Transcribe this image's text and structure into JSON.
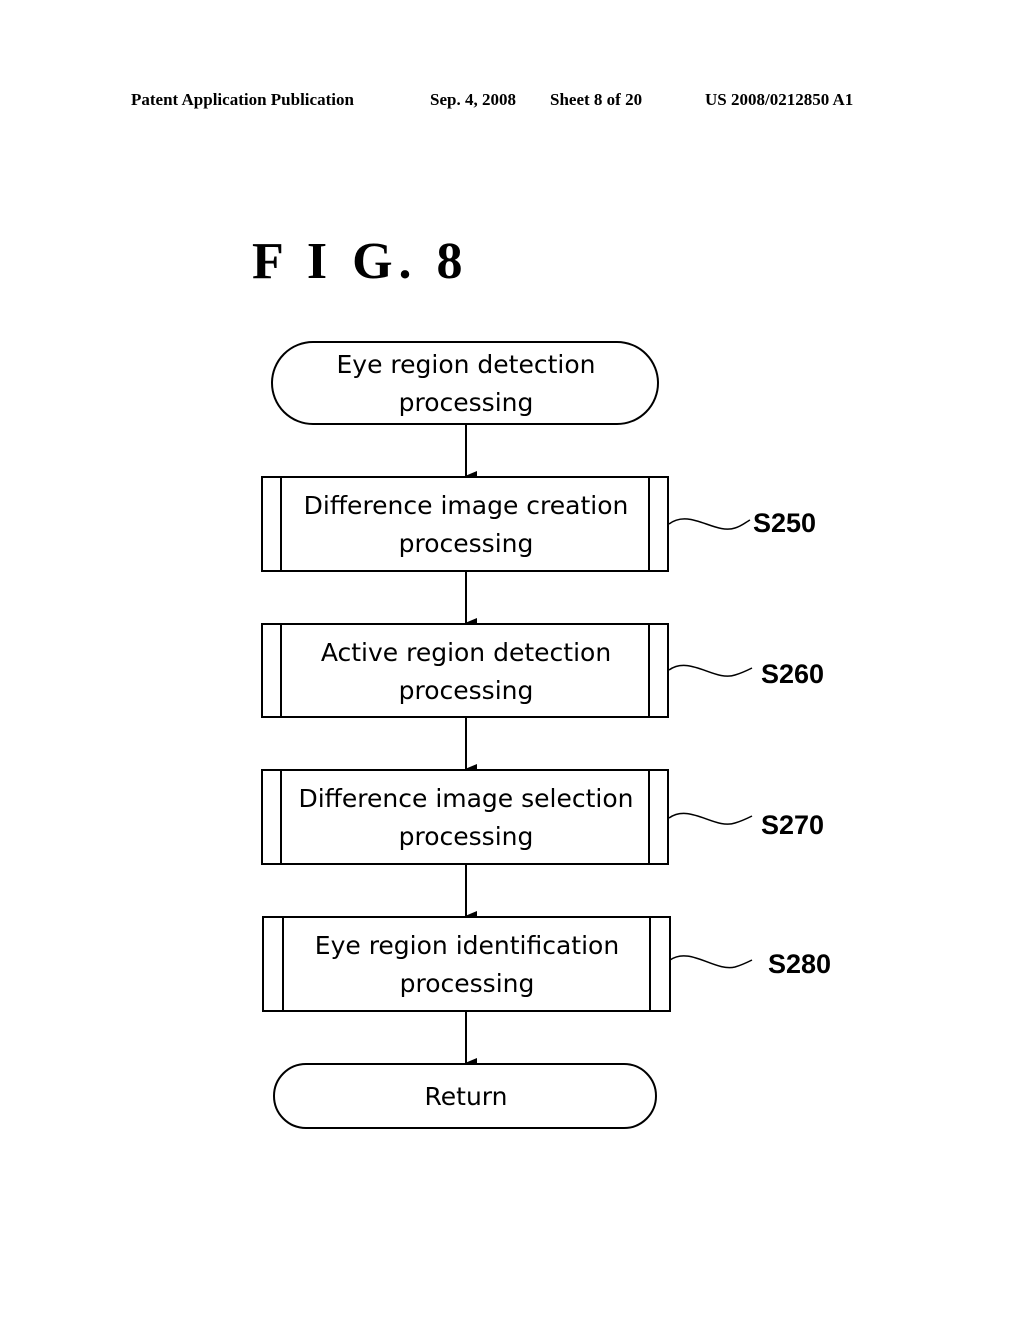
{
  "header": {
    "publication": "Patent Application Publication",
    "date": "Sep. 4, 2008",
    "sheet": "Sheet 8 of 20",
    "number": "US 2008/0212850 A1"
  },
  "figure": {
    "title": "F I G. 8"
  },
  "flowchart": {
    "start": {
      "line1": "Eye region detection",
      "line2": "processing"
    },
    "steps": [
      {
        "line1": "Difference image creation",
        "line2": "processing",
        "label": "S250"
      },
      {
        "line1": "Active region detection",
        "line2": "processing",
        "label": "S260"
      },
      {
        "line1": "Difference image selection",
        "line2": "processing",
        "label": "S270"
      },
      {
        "line1": "Eye region identification",
        "line2": "processing",
        "label": "S280"
      }
    ],
    "end": {
      "line1": "Return"
    }
  }
}
